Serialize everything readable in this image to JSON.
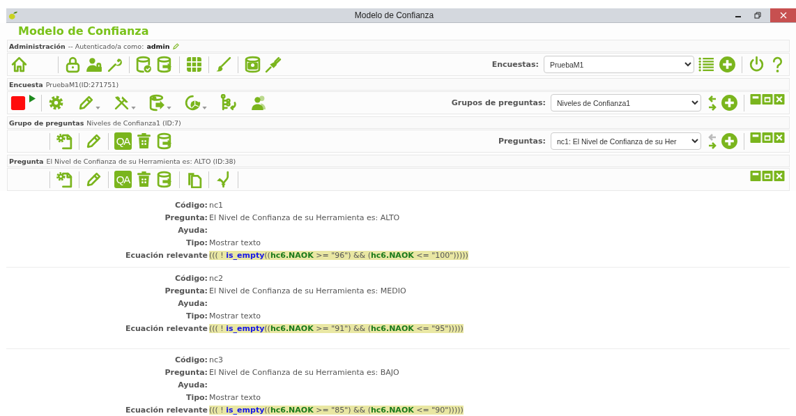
{
  "window": {
    "title": "Modelo de Confianza"
  },
  "app_title": "Modelo de Confianza",
  "admin_bar": {
    "heading": "Administración",
    "text": "-- Autenticado/a como:",
    "user": "admin"
  },
  "survey_selector": {
    "label": "Encuestas:",
    "value": "PruebaM1"
  },
  "survey_bar": {
    "heading": "Encuesta",
    "text": "PruebaM1(ID:271751)"
  },
  "group_selector": {
    "label": "Grupos de preguntas:",
    "value": "Niveles de Confianza1",
    "previous_disabled": false
  },
  "group_bar": {
    "heading": "Grupo de preguntas",
    "text": "Niveles de Confianza1 (ID:7)",
    "qa": "QA"
  },
  "question_selector": {
    "label": "Preguntas:",
    "value": "nc1: El Nivel de Confianza de su Her",
    "previous_disabled": true
  },
  "question_bar": {
    "heading": "Pregunta",
    "text": "El Nivel de Confianza de su Herramienta es: ALTO (ID:38)",
    "qa": "QA"
  },
  "questions": [
    {
      "fields": [
        {
          "label": "Código:",
          "value": "nc1"
        },
        {
          "label": "Pregunta:",
          "value": "El Nivel de Confianza de su Herramienta es: ALTO"
        },
        {
          "label": "Ayuda:"
        },
        {
          "label": "Tipo:",
          "value": "Mostrar texto"
        }
      ],
      "equation_label": "Ecuación relevante",
      "equation": [
        {
          "kind": "plain",
          "text": "((( ! "
        },
        {
          "kind": "function",
          "text": "is_empty"
        },
        {
          "kind": "plain",
          "text": "(("
        },
        {
          "kind": "variable",
          "text": "hc6.NAOK"
        },
        {
          "kind": "plain",
          "text": " >= \"96\") && ("
        },
        {
          "kind": "variable",
          "text": "hc6.NAOK"
        },
        {
          "kind": "plain",
          "text": " <= \"100\")))))"
        }
      ]
    },
    {
      "fields": [
        {
          "label": "Código:",
          "value": "nc2"
        },
        {
          "label": "Pregunta:",
          "value": "El Nivel de Confianza de su Herramienta es: MEDIO"
        },
        {
          "label": "Ayuda:"
        },
        {
          "label": "Tipo:",
          "value": "Mostrar texto"
        }
      ],
      "equation_label": "Ecuación relevante",
      "equation": [
        {
          "kind": "plain",
          "text": "((( ! "
        },
        {
          "kind": "function",
          "text": "is_empty"
        },
        {
          "kind": "plain",
          "text": "(("
        },
        {
          "kind": "variable",
          "text": "hc6.NAOK"
        },
        {
          "kind": "plain",
          "text": " >= \"91\") && ("
        },
        {
          "kind": "variable",
          "text": "hc6.NAOK"
        },
        {
          "kind": "plain",
          "text": " <= \"95\")))))"
        }
      ]
    },
    {
      "fields": [
        {
          "label": "Código:",
          "value": "nc3"
        },
        {
          "label": "Pregunta:",
          "value": "El Nivel de Confianza de su Herramienta es: BAJO"
        },
        {
          "label": "Ayuda:"
        },
        {
          "label": "Tipo:",
          "value": "Mostrar texto"
        }
      ],
      "equation_label": "Ecuación relevante",
      "equation": [
        {
          "kind": "plain",
          "text": "((( ! "
        },
        {
          "kind": "function",
          "text": "is_empty"
        },
        {
          "kind": "plain",
          "text": "(("
        },
        {
          "kind": "variable",
          "text": "hc6.NAOK"
        },
        {
          "kind": "plain",
          "text": " >= \"85\") && ("
        },
        {
          "kind": "variable",
          "text": "hc6.NAOK"
        },
        {
          "kind": "plain",
          "text": " <= \"90\")))))"
        }
      ]
    }
  ]
}
